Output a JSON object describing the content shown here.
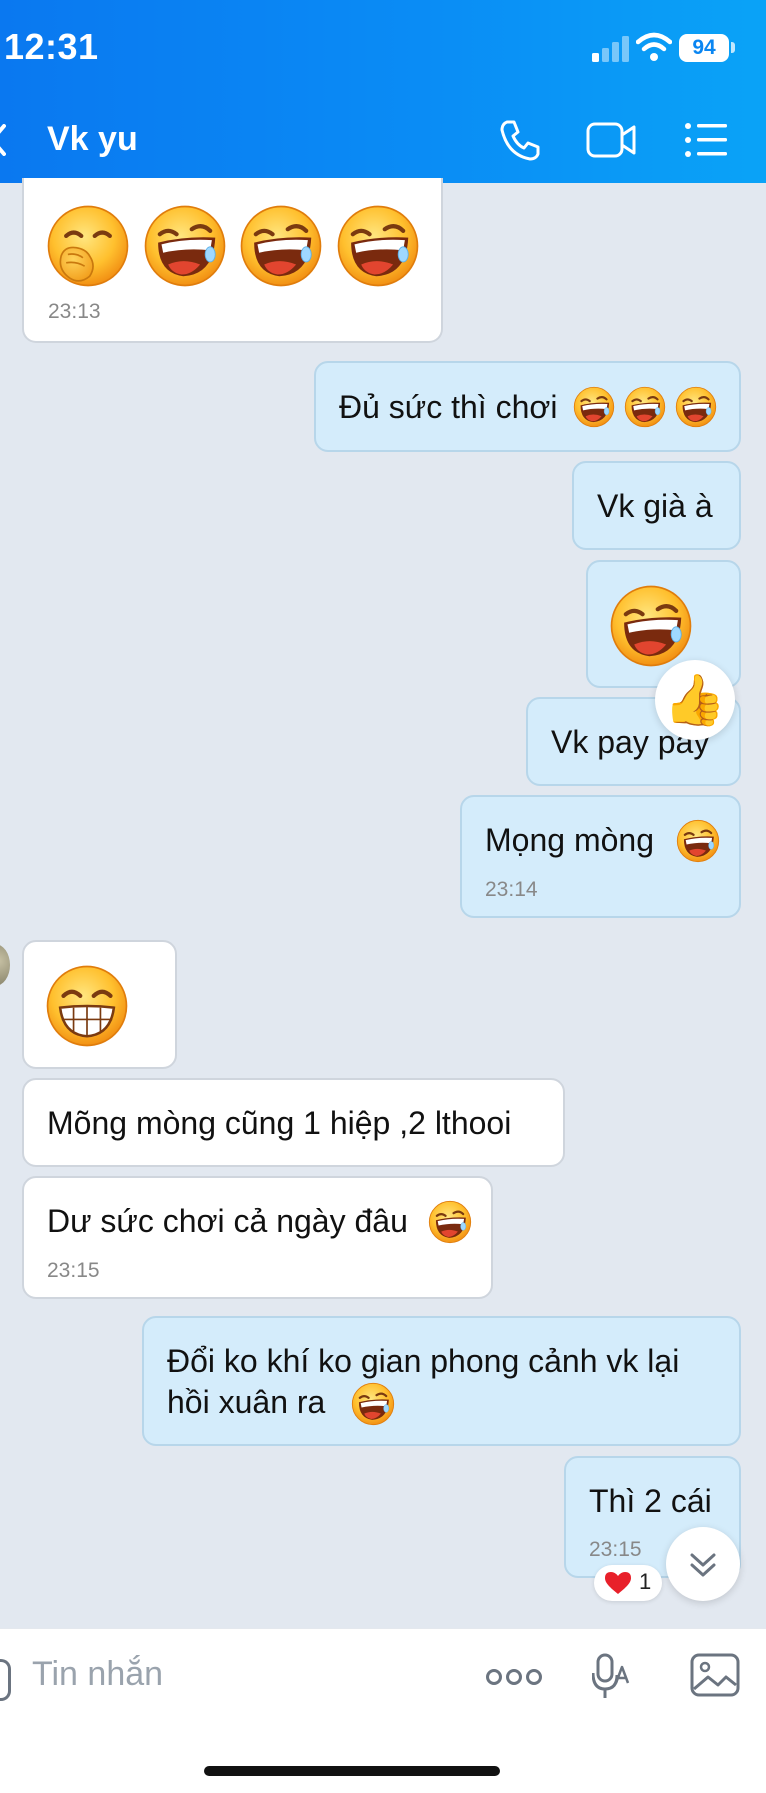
{
  "status_bar": {
    "time": "12:31",
    "battery": "94"
  },
  "header": {
    "title": "Vk yu"
  },
  "messages": {
    "m1": {
      "time": "23:13"
    },
    "m2": {
      "text": "Đủ sức thì chơi"
    },
    "m3": {
      "text": "Vk già à"
    },
    "m5": {
      "text": "Vk pay pay"
    },
    "m6": {
      "text": "Mọng mòng",
      "time": "23:14"
    },
    "m8": {
      "text": "Mõng mòng cũng 1 hiệp ,2 lthooi"
    },
    "m9": {
      "text": "Dư sức chơi cả ngày đâu",
      "time": "23:15"
    },
    "m10": {
      "line1": "Đổi ko khí ko gian phong cảnh vk lại",
      "line2": "hồi xuân  ra"
    },
    "m11": {
      "text": "Thì 2 cái",
      "time": "23:15"
    }
  },
  "reaction": {
    "count": "1"
  },
  "input": {
    "placeholder": "Tin nhắn"
  },
  "icons": {
    "laughing": "laughing-face-emoji",
    "hand_over_mouth": "face-with-hand-over-mouth-emoji",
    "grinning": "grinning-face-emoji",
    "thumbs_up": "thumbs-up-reaction",
    "heart": "heart-reaction"
  }
}
